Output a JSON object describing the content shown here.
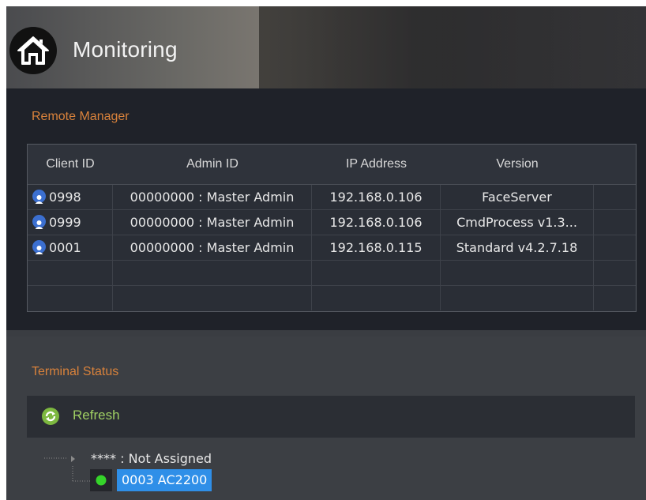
{
  "header": {
    "title": "Monitoring"
  },
  "remote_manager": {
    "title": "Remote Manager",
    "columns": [
      "Client ID",
      "Admin ID",
      "IP Address",
      "Version"
    ],
    "rows": [
      {
        "client_id": "0998",
        "admin_id": "00000000 : Master Admin",
        "ip": "192.168.0.106",
        "version": "FaceServer"
      },
      {
        "client_id": "0999",
        "admin_id": "00000000 : Master Admin",
        "ip": "192.168.0.106",
        "version": "CmdProcess v1.3..."
      },
      {
        "client_id": "0001",
        "admin_id": "00000000 : Master Admin",
        "ip": "192.168.0.115",
        "version": "Standard v4.2.7.18"
      }
    ]
  },
  "terminal_status": {
    "title": "Terminal Status",
    "refresh_label": "Refresh",
    "tree": {
      "group_label": "**** : Not Assigned",
      "child_label": "0003 AC2200",
      "child_status_color": "#35d42a"
    }
  },
  "colors": {
    "accent": "#d9823b",
    "refresh": "#9fcf63",
    "selection": "#2f8fe8",
    "user_icon": "#3b6fd0"
  }
}
